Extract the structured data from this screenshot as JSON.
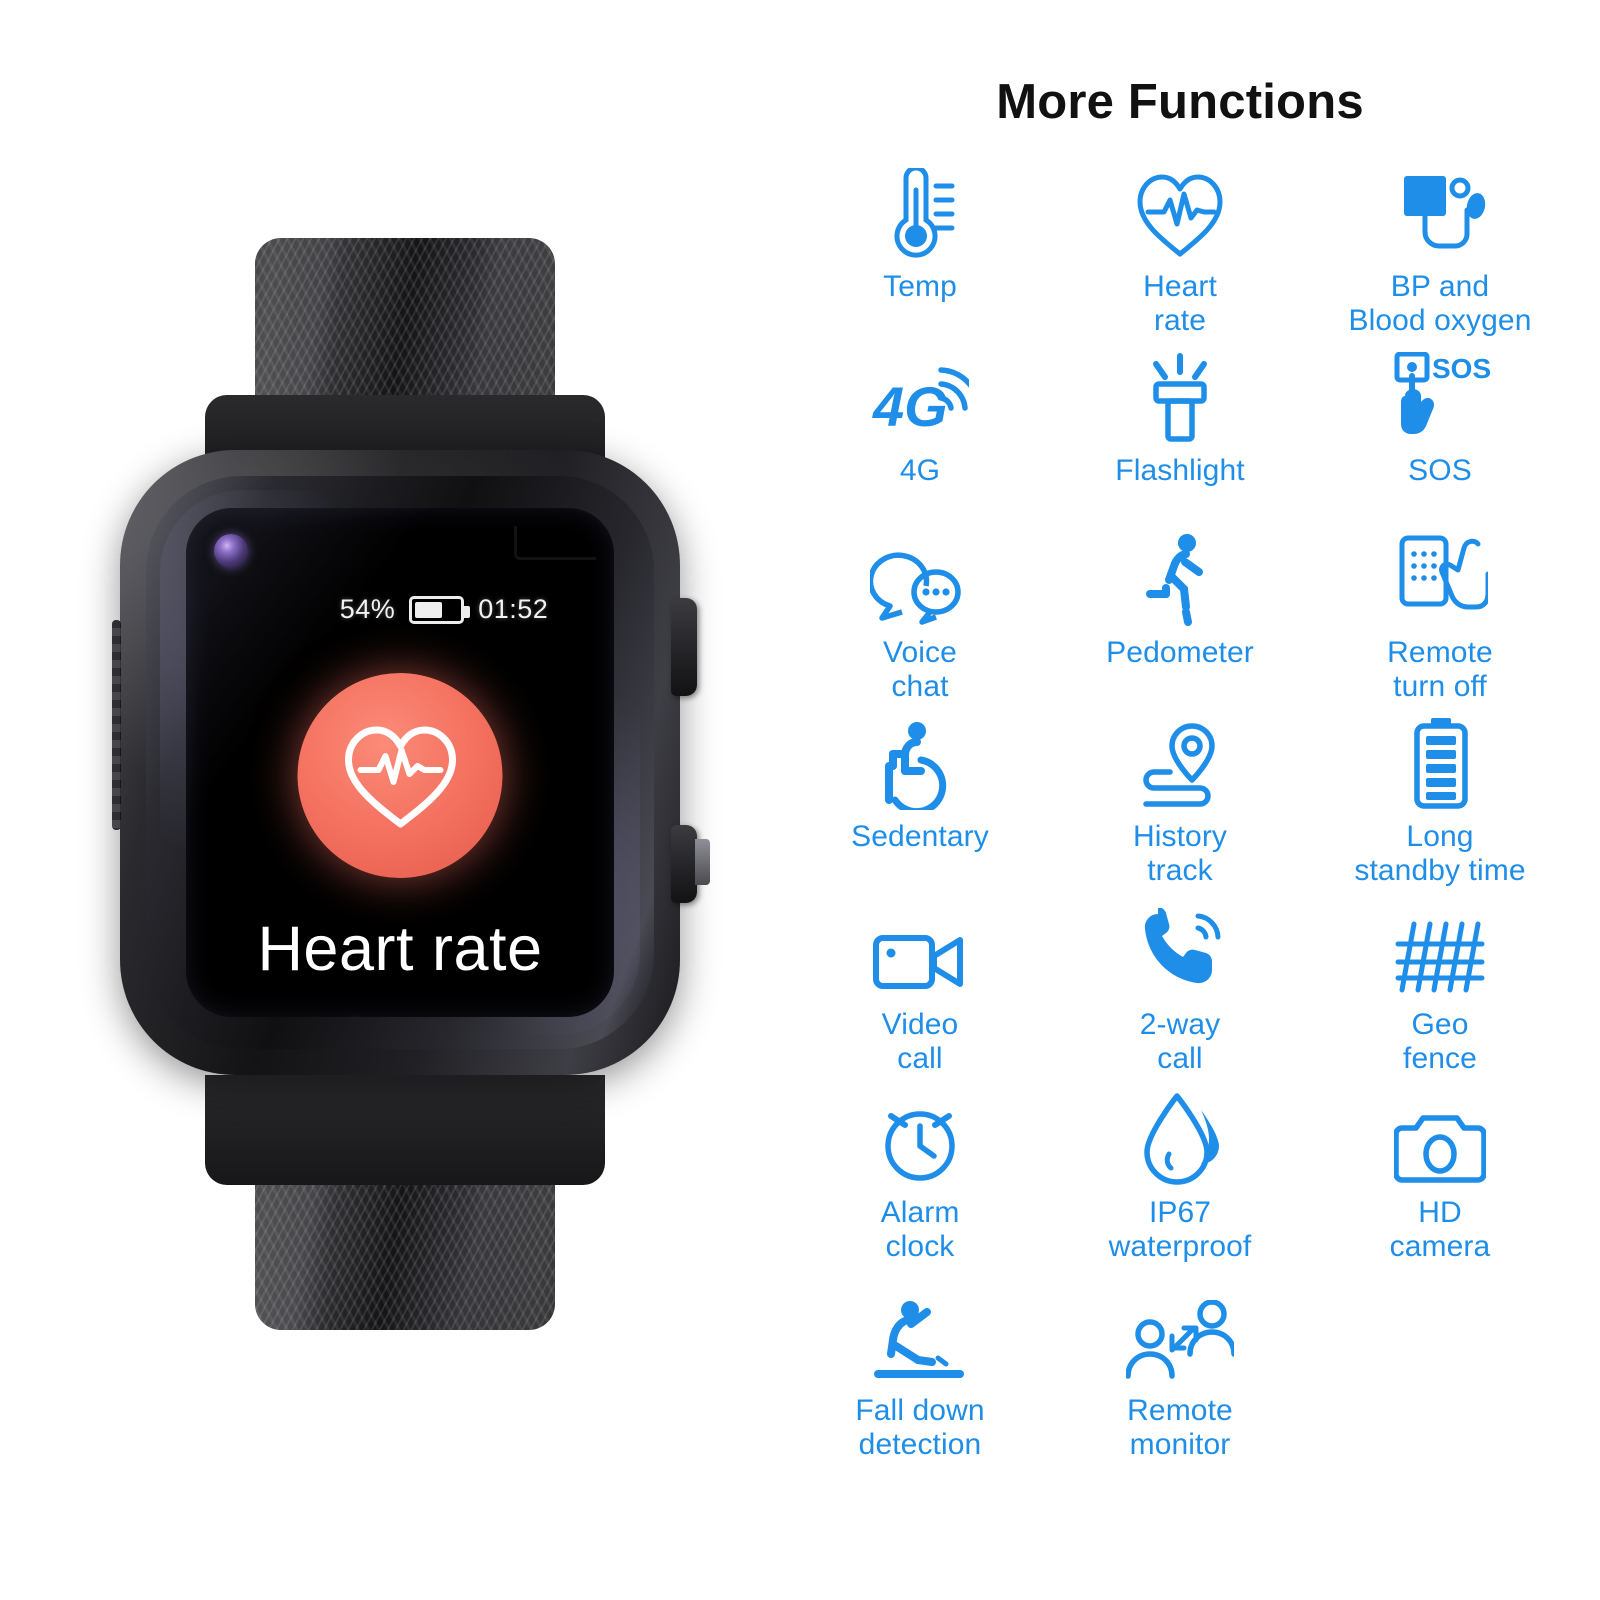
{
  "watch": {
    "status": {
      "battery_percent": "54%",
      "battery_level": 54,
      "time": "01:52"
    },
    "screen": {
      "app_label": "Heart rate",
      "dot_count": 19,
      "active_dot_index": 7
    },
    "icons": {
      "camera": "camera-lens-icon",
      "heart": "heart-pulse-icon",
      "home": "home-button-icon",
      "battery": "battery-icon"
    }
  },
  "features": {
    "title": "More Functions",
    "accent_color": "#1e8ee8",
    "rows": [
      [
        {
          "label": "Temp",
          "icon": "thermometer-icon"
        },
        {
          "label": "Heart\nrate",
          "icon": "heart-pulse-icon"
        },
        {
          "label": "BP and\nBlood oxygen",
          "icon": "blood-pressure-cuff-icon"
        }
      ],
      [
        {
          "label": "4G",
          "icon": "4g-signal-icon"
        },
        {
          "label": "Flashlight",
          "icon": "flashlight-icon"
        },
        {
          "label": "SOS",
          "icon": "sos-hand-icon"
        }
      ],
      [
        {
          "label": "Voice\nchat",
          "icon": "speech-bubbles-icon"
        },
        {
          "label": "Pedometer",
          "icon": "running-person-icon"
        },
        {
          "label": "Remote\nturn off",
          "icon": "hand-phone-icon"
        }
      ],
      [
        {
          "label": "Sedentary",
          "icon": "seated-person-icon"
        },
        {
          "label": "History\ntrack",
          "icon": "map-pin-route-icon"
        },
        {
          "label": "Long\nstandby time",
          "icon": "battery-full-icon"
        }
      ],
      [
        {
          "label": "Video\ncall",
          "icon": "video-camera-icon"
        },
        {
          "label": "2-way\ncall",
          "icon": "phone-waves-icon"
        },
        {
          "label": "Geo\nfence",
          "icon": "fence-icon"
        }
      ],
      [
        {
          "label": "Alarm\nclock",
          "icon": "alarm-clock-icon"
        },
        {
          "label": "IP67\nwaterproof",
          "icon": "water-drop-icon"
        },
        {
          "label": "HD\ncamera",
          "icon": "camera-icon"
        }
      ],
      [
        {
          "label": "Fall down\ndetection",
          "icon": "falling-person-icon"
        },
        {
          "label": "Remote\nmonitor",
          "icon": "two-people-arrows-icon"
        },
        {
          "label": "",
          "icon": ""
        }
      ]
    ]
  }
}
